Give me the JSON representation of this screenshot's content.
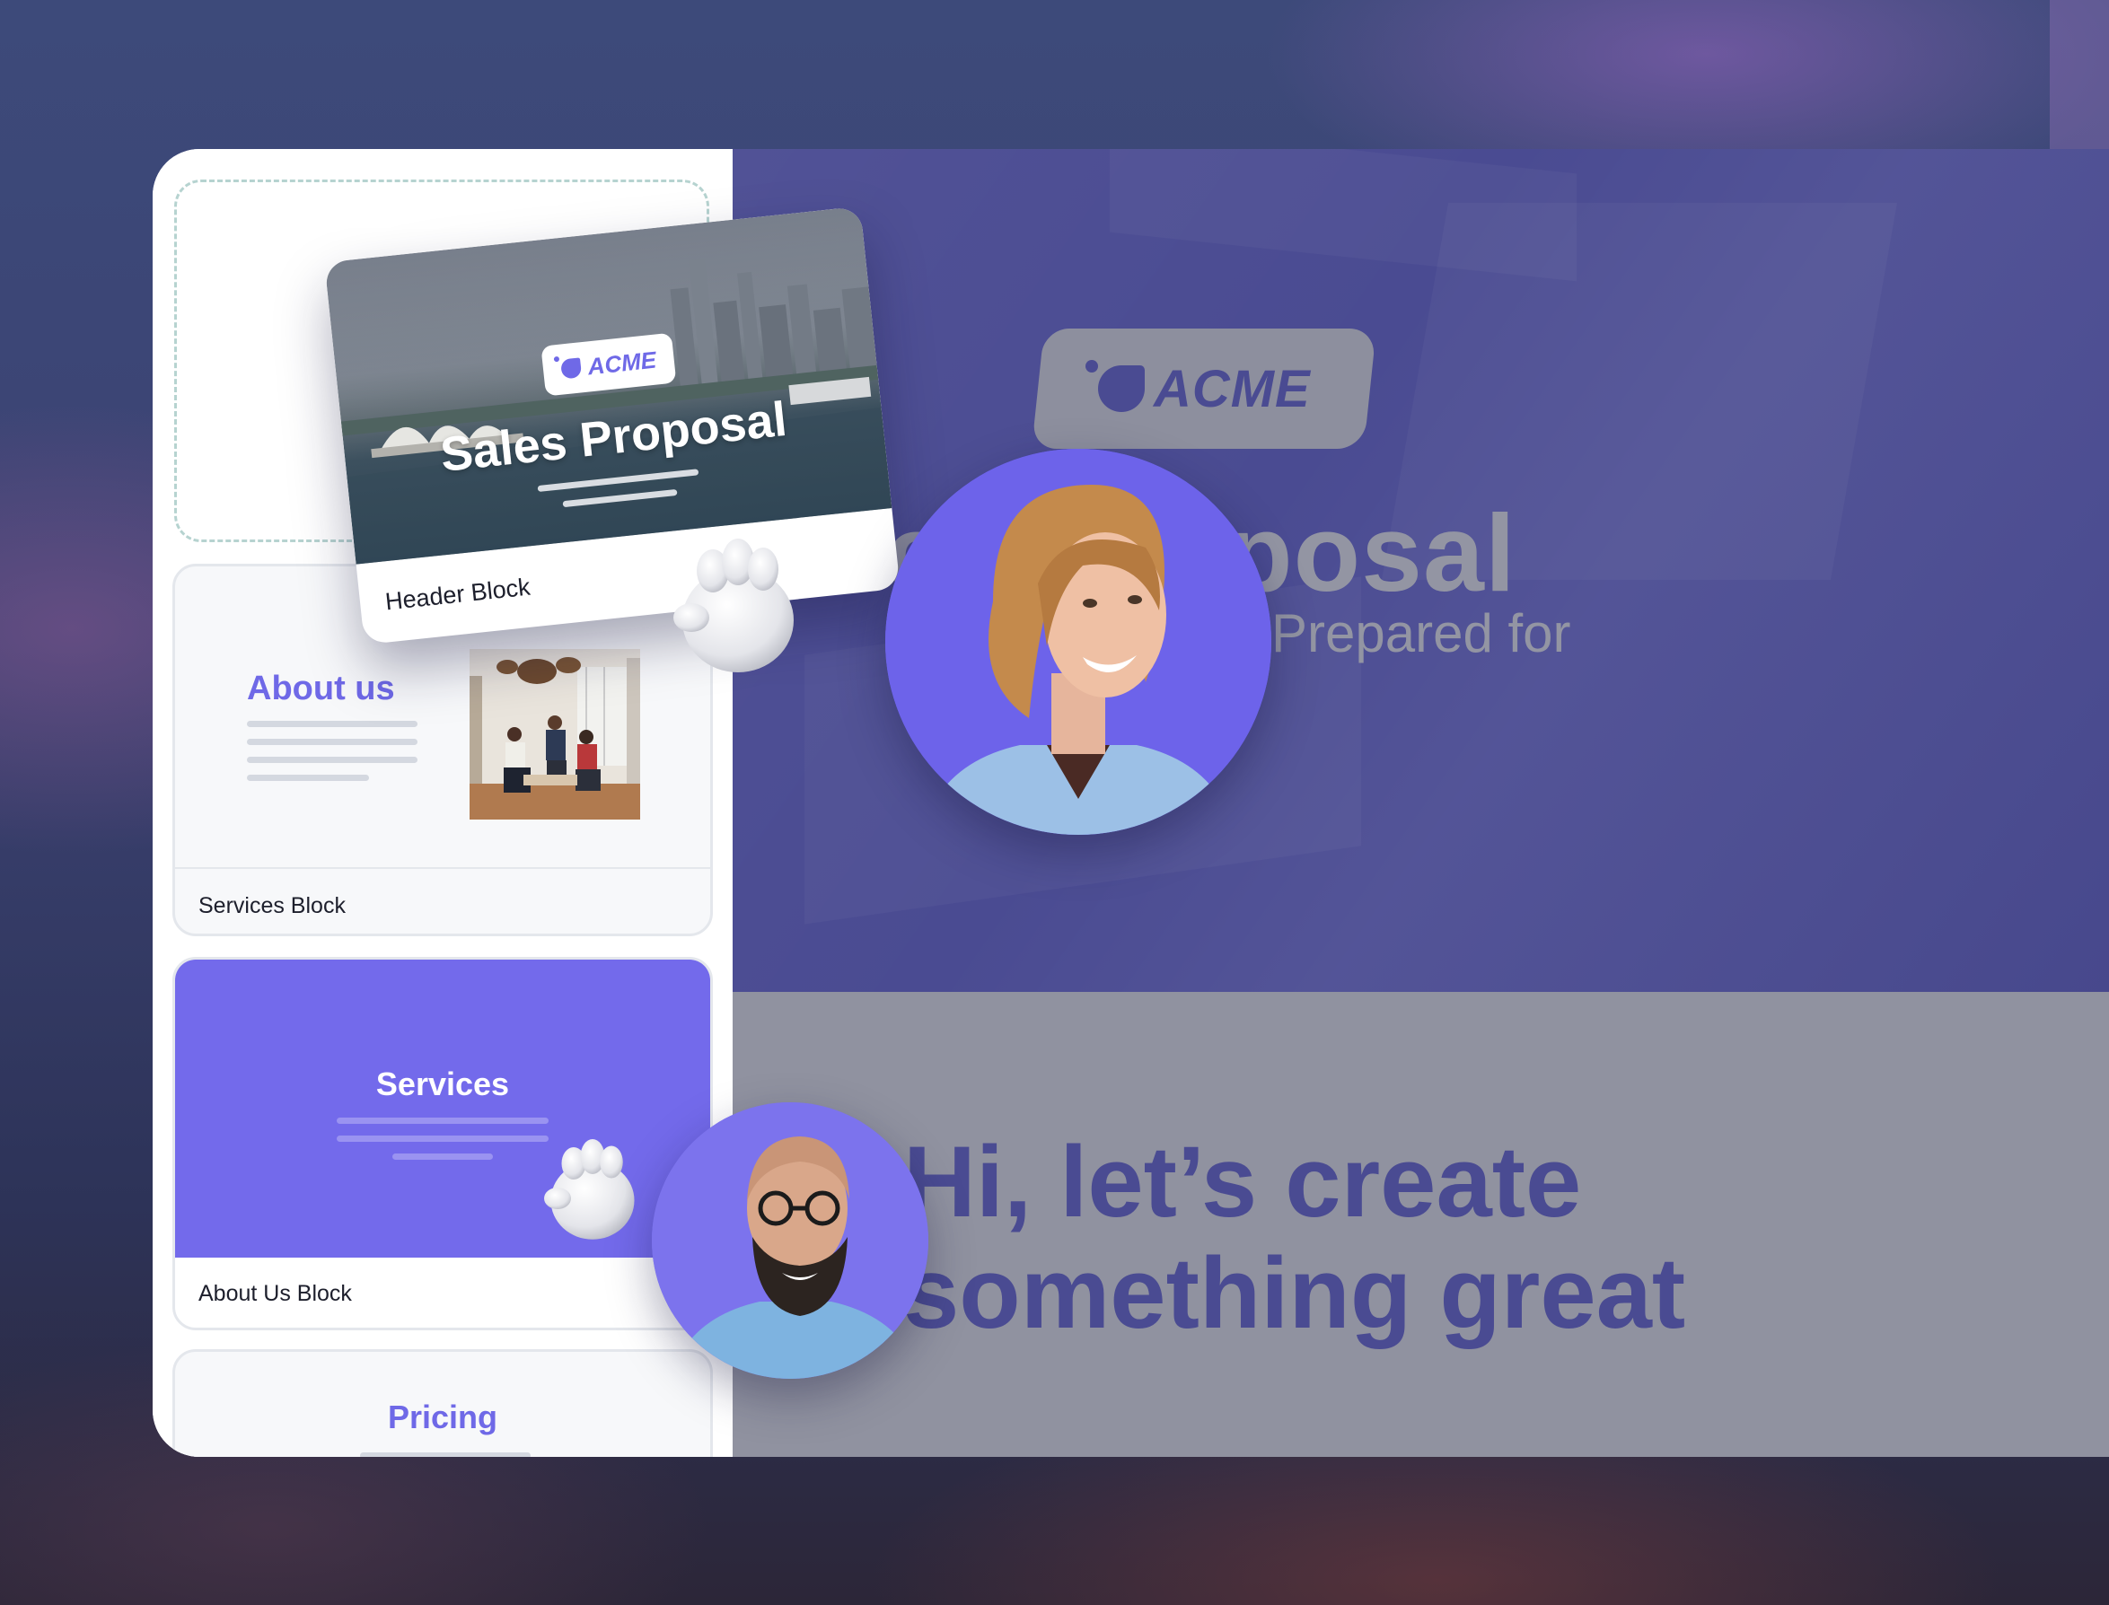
{
  "sidebar": {
    "header_card": {
      "logo_text": "ACME",
      "title": "Sales Proposal",
      "label": "Header Block"
    },
    "cards": [
      {
        "title": "About us",
        "label": "Services Block"
      },
      {
        "title": "Services",
        "label": "About Us Block"
      },
      {
        "title": "Pricing"
      }
    ]
  },
  "canvas": {
    "hero": {
      "logo_text": "ACME",
      "title": "Sales Proposal",
      "subtitle": "Prepared for"
    },
    "lower": {
      "line1": "Hi, let’s create",
      "line2": "something great"
    }
  },
  "colors": {
    "accent": "#736aeb",
    "hero_bg": "#4a4b92",
    "lower_bg": "#9092a0",
    "text_dark": "#1d1f2c"
  },
  "icons": [
    "acme-logo-icon",
    "grab-hand-icon",
    "woman-avatar",
    "man-avatar"
  ]
}
